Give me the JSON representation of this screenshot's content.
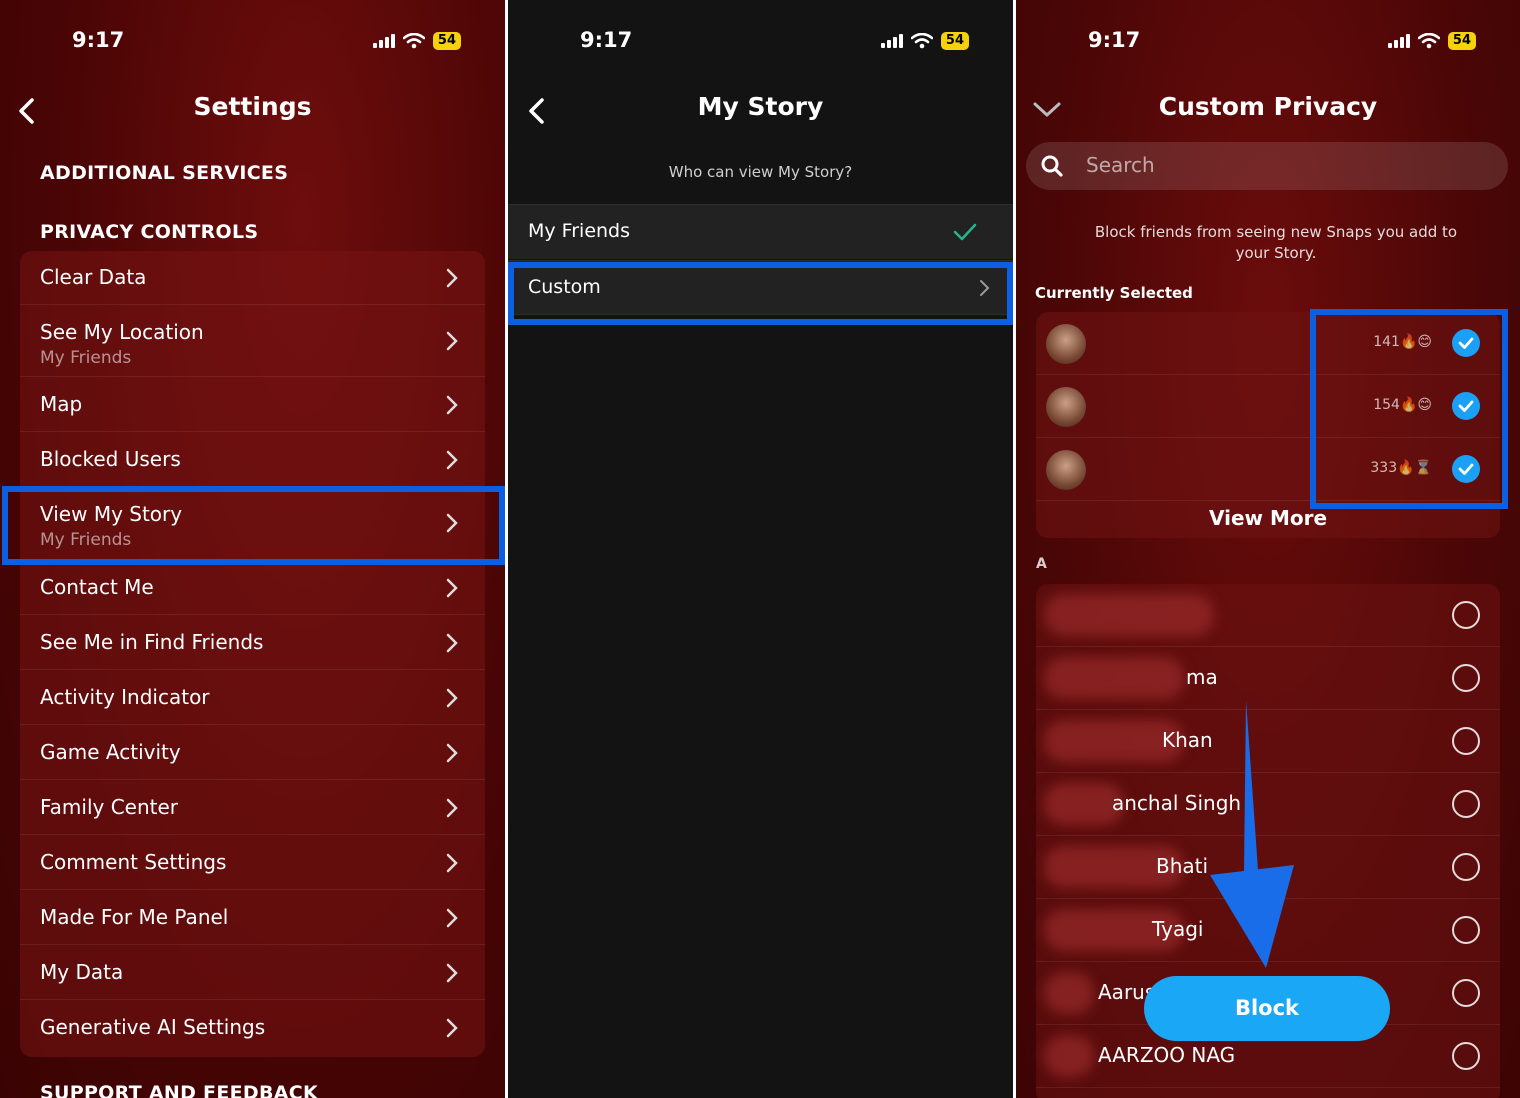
{
  "status": {
    "time": "9:17",
    "battery": "54"
  },
  "settings": {
    "title": "Settings",
    "section_additional": "ADDITIONAL SERVICES",
    "section_privacy": "PRIVACY CONTROLS",
    "items": [
      {
        "label": "Clear Data"
      },
      {
        "label": "See My Location",
        "sub": "My Friends"
      },
      {
        "label": "Map"
      },
      {
        "label": "Blocked Users"
      },
      {
        "label": "View My Story",
        "sub": "My Friends"
      },
      {
        "label": "Contact Me"
      },
      {
        "label": "See Me in Find Friends"
      },
      {
        "label": "Activity Indicator"
      },
      {
        "label": "Game Activity"
      },
      {
        "label": "Family Center"
      },
      {
        "label": "Comment Settings"
      },
      {
        "label": "Made For Me Panel"
      },
      {
        "label": "My Data"
      },
      {
        "label": "Generative AI Settings"
      }
    ],
    "section_support": "SUPPORT AND FEEDBACK"
  },
  "mystory": {
    "title": "My Story",
    "subtitle": "Who can view My Story?",
    "options": [
      {
        "label": "My Friends",
        "selected": true
      },
      {
        "label": "Custom"
      }
    ]
  },
  "privacy": {
    "title": "Custom Privacy",
    "search_placeholder": "Search",
    "info": "Block friends from seeing new Snaps you add to your Story.",
    "currently_selected": "Currently Selected",
    "selected": [
      {
        "streak": "141",
        "emoji": "🔥😊"
      },
      {
        "streak": "154",
        "emoji": "🔥😊"
      },
      {
        "streak": "333",
        "emoji": "🔥⌛"
      }
    ],
    "view_more": "View More",
    "letter": "A",
    "friends": [
      {
        "name": ""
      },
      {
        "name": "ma"
      },
      {
        "name": "Khan"
      },
      {
        "name": "anchal Singh"
      },
      {
        "name": "Bhati"
      },
      {
        "name": "Tyagi"
      },
      {
        "name": "Aarus"
      },
      {
        "name": "AARZOO NAG"
      }
    ],
    "block_label": "Block"
  },
  "colors": {
    "highlight": "#0b5fe0",
    "accent": "#1aa7f5",
    "arrow": "#1a6de8"
  }
}
